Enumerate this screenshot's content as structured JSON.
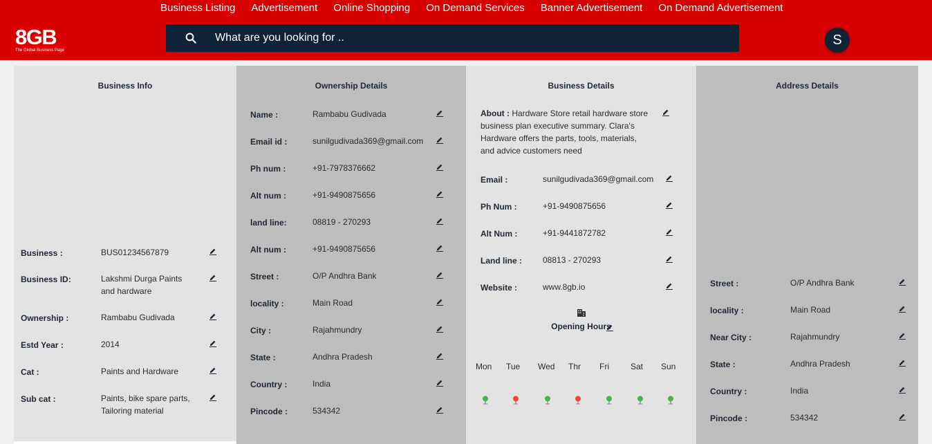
{
  "nav": {
    "items": [
      "Business Listing",
      "Advertisement",
      "Online Shopping",
      "On Demand Services",
      "Banner Advertisement",
      "On Demand Advertisement"
    ]
  },
  "logo": {
    "main": "8GB",
    "sub": "The Global Business Page"
  },
  "search": {
    "placeholder": "What are you looking for .."
  },
  "user": {
    "initial": "S"
  },
  "business_info": {
    "title": "Business Info",
    "rows": [
      {
        "label": "Business :",
        "value": "BUS01234567879"
      },
      {
        "label": "Business ID:",
        "value": "Lakshmi Durga Paints and hardware"
      },
      {
        "label": "Ownership :",
        "value": "Rambabu Gudivada"
      },
      {
        "label": "Estd Year :",
        "value": "2014"
      },
      {
        "label": "Cat :",
        "value": "Paints and Hardware"
      },
      {
        "label": "Sub cat :",
        "value": "Paints, bike spare parts, Tailoring material"
      }
    ]
  },
  "ownership": {
    "title": "Ownership Details",
    "rows": [
      {
        "label": "Name :",
        "value": "Rambabu Gudivada"
      },
      {
        "label": "Email id :",
        "value": "sunilgudivada369@gmail.com"
      },
      {
        "label": "Ph num :",
        "value": "+91-7978376662"
      },
      {
        "label": "Alt num :",
        "value": "+91-9490875656"
      },
      {
        "label": "land line:",
        "value": "08819 - 270293"
      },
      {
        "label": "Alt num :",
        "value": "+91-9490875656"
      },
      {
        "label": "Street :",
        "value": "O/P Andhra Bank"
      },
      {
        "label": "locality :",
        "value": "Main Road"
      },
      {
        "label": "City :",
        "value": "Rajahmundry"
      },
      {
        "label": "State :",
        "value": "Andhra Pradesh"
      },
      {
        "label": "Country :",
        "value": "India"
      },
      {
        "label": "Pincode :",
        "value": "534342"
      }
    ]
  },
  "business_details": {
    "title": "Business Details",
    "about_label": "About :",
    "about_text": "Hardware Store retail hardware store business plan executive summary. Clara's Hardware offers the parts, tools, materials, and advice customers need",
    "rows": [
      {
        "label": "Email :",
        "value": "sunilgudivada369@gmail.com"
      },
      {
        "label": "Ph Num :",
        "value": "+91-9490875656"
      },
      {
        "label": "Alt Num :",
        "value": "+91-9441872782"
      },
      {
        "label": "Land line :",
        "value": "08813 - 270293"
      },
      {
        "label": "Website :",
        "value": "www.8gb.io"
      }
    ],
    "opening_hours": "Opening Hours",
    "days": [
      {
        "name": "Mon",
        "color": "#4caf50"
      },
      {
        "name": "Tue",
        "color": "#f44336"
      },
      {
        "name": "Wed",
        "color": "#4caf50"
      },
      {
        "name": "Thr",
        "color": "#f44336"
      },
      {
        "name": "Fri",
        "color": "#4caf50"
      },
      {
        "name": "Sat",
        "color": "#4caf50"
      },
      {
        "name": "Sun",
        "color": "#4caf50"
      }
    ]
  },
  "address": {
    "title": "Address Details",
    "rows": [
      {
        "label": "Street :",
        "value": "O/P Andhra Bank"
      },
      {
        "label": "locality :",
        "value": "Main Road"
      },
      {
        "label": "Near City :",
        "value": "Rajahmundry"
      },
      {
        "label": "State :",
        "value": "Andhra Pradesh"
      },
      {
        "label": "Country :",
        "value": "India"
      },
      {
        "label": "Pincode :",
        "value": "534342"
      }
    ]
  },
  "colors": {
    "header": "#d90000",
    "search_bg": "#0f2338",
    "panel_light": "#e3e3e3",
    "panel_dark": "#bdbdbd",
    "open": "#4caf50",
    "closed": "#f44336"
  }
}
